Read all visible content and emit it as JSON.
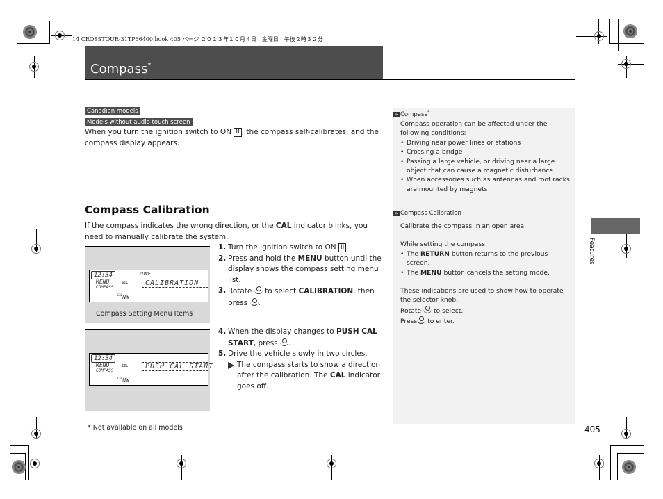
{
  "print_header": "14 CROSSTOUR-31TP66400.book  405 ページ  ２０１３年１０月４日　金曜日　午後２時３２分",
  "page": {
    "title": "Compass",
    "title_mark": "*",
    "page_number": "405",
    "section_tab": "Features",
    "footnote": "* Not available on all models"
  },
  "intro": {
    "tags": [
      "Canadian models",
      "Models without audio touch screen"
    ],
    "text_before_key": "When you turn the ignition switch to ON",
    "key": "II",
    "text_after_key": ", the compass self-calibrates, and the compass display appears."
  },
  "calibration": {
    "heading": "Compass Calibration",
    "intro_pre": "If the compass indicates the wrong direction, or the",
    "intro_bold": "CAL",
    "intro_post": "indicator blinks, you need to manually calibrate the system.",
    "image_caption": "Compass Setting Menu Items",
    "steps": [
      {
        "num": "1.",
        "pre": "Turn the ignition switch to ON",
        "key": "II",
        "post": "."
      },
      {
        "num": "2.",
        "pre": "Press and hold the",
        "bold": "MENU",
        "post": "button until the display shows the compass setting menu list."
      },
      {
        "num": "3.",
        "pre": "Rotate",
        "mid": "to select",
        "bold": "CALIBRATION",
        "post": ", then press"
      },
      {
        "num": "4.",
        "pre": "When the display changes to",
        "bold": "PUSH CAL START",
        "post": ", press"
      },
      {
        "num": "5.",
        "pre": "Drive the vehicle slowly in two circles."
      }
    ],
    "note_pre": "The compass starts to show a direction after the calibration. The",
    "note_bold": "CAL",
    "note_post": "indicator goes off."
  },
  "lcd1": {
    "time": "12:34",
    "menu": "MENU",
    "mode": "COMPASS",
    "sel": "SEL",
    "zone": "ZONE",
    "item": "CALIBRATION",
    "cal": "CAL",
    "dir": "NW"
  },
  "lcd2": {
    "time": "12:34",
    "menu": "MENU",
    "mode": "COMPASS",
    "sel": "SEL",
    "item": "PUSH CAL START",
    "cal": "CAL",
    "dir": "NW"
  },
  "sidebar": {
    "compass": {
      "head": "Compass",
      "mark": "*",
      "text": "Compass operation can be affected under the following conditions:",
      "bullets": [
        "Driving near power lines or stations",
        "Crossing a bridge",
        "Passing a large vehicle, or driving near a large object that can cause a magnetic disturbance",
        "When accessories such as antennas and roof racks are mounted by magnets"
      ]
    },
    "calibration": {
      "head": "Compass Calibration",
      "p1": "Calibrate the compass in an open area.",
      "p2": "While setting the compass:",
      "b1_pre": "The",
      "b1_bold": "RETURN",
      "b1_post": "button returns to the previous screen.",
      "b2_pre": "The",
      "b2_bold": "MENU",
      "b2_post": "button cancels the setting mode.",
      "p3": "These indications are used to show how to operate the selector knob.",
      "rotate_pre": "Rotate",
      "rotate_post": "to select.",
      "press_pre": "Press",
      "press_post": "to enter."
    }
  }
}
